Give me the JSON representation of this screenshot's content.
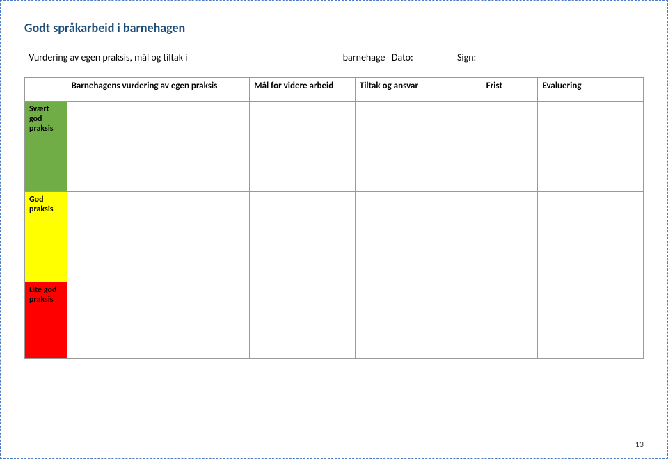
{
  "header": {
    "title": "Godt språkarbeid i barnehagen",
    "subtitle_prefix": "Vurdering av egen praksis, mål og tiltak i",
    "label_barnehage": " barnehage   Dato:",
    "label_sign": " Sign:"
  },
  "table": {
    "columns": {
      "c1": "",
      "c2": "Barnehagens vurdering av egen praksis",
      "c3": "Mål for videre arbeid",
      "c4": "Tiltak og ansvar",
      "c5": "Frist",
      "c6": "Evaluering"
    },
    "rows": {
      "r1": "Svært god praksis",
      "r2": "God praksis",
      "r3": "Lite god praksis"
    }
  },
  "page_number": "13"
}
